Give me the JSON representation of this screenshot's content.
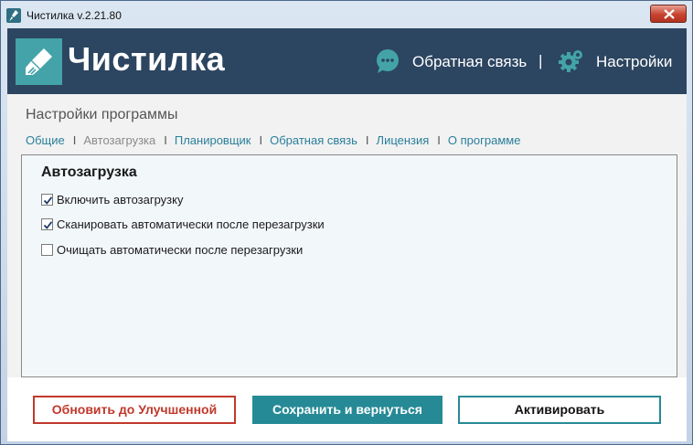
{
  "window": {
    "title": "Чистилка v.2.21.80"
  },
  "header": {
    "logo_text": "Чистилка",
    "feedback_label": "Обратная связь",
    "separator": "|",
    "settings_label": "Настройки"
  },
  "page": {
    "title": "Настройки программы"
  },
  "tabs": [
    {
      "label": "Общие",
      "active": false
    },
    {
      "label": "Автозагрузка",
      "active": true
    },
    {
      "label": "Планировщик",
      "active": false
    },
    {
      "label": "Обратная связь",
      "active": false
    },
    {
      "label": "Лицензия",
      "active": false
    },
    {
      "label": "О программе",
      "active": false
    }
  ],
  "tab_separator": "I",
  "panel": {
    "heading": "Автозагрузка",
    "options": [
      {
        "label": "Включить автозагрузку",
        "checked": true
      },
      {
        "label": "Сканировать автоматически после перезагрузки",
        "checked": true
      },
      {
        "label": "Очищать автоматически после перезагрузки",
        "checked": false
      }
    ]
  },
  "buttons": {
    "upgrade": "Обновить до Улучшенной",
    "save": "Сохранить и вернуться",
    "activate": "Активировать"
  },
  "colors": {
    "header_bg": "#2c4560",
    "accent": "#268a96",
    "upgrade": "#c0392b",
    "link": "#2a7f9a"
  }
}
